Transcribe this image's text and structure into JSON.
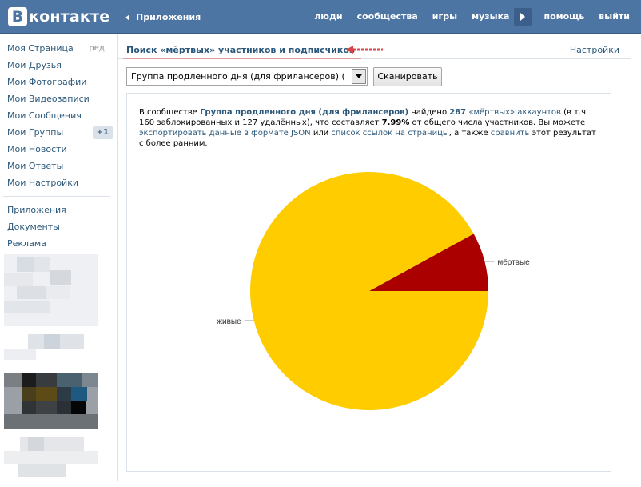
{
  "header": {
    "logo_letter": "В",
    "logo_text": "контакте",
    "apps_label": "Приложения",
    "nav": [
      "люди",
      "сообщества",
      "игры",
      "музыка",
      "помощь",
      "выйти"
    ]
  },
  "sidebar": {
    "items": [
      {
        "label": "Моя Страница",
        "extra": "ред."
      },
      {
        "label": "Мои Друзья"
      },
      {
        "label": "Мои Фотографии"
      },
      {
        "label": "Мои Видеозаписи"
      },
      {
        "label": "Мои Сообщения"
      },
      {
        "label": "Мои Группы",
        "count": "+1"
      },
      {
        "label": "Мои Новости"
      },
      {
        "label": "Мои Ответы"
      },
      {
        "label": "Мои Настройки"
      }
    ],
    "secondary": [
      {
        "label": "Приложения"
      },
      {
        "label": "Документы"
      },
      {
        "label": "Реклама"
      }
    ]
  },
  "main": {
    "tab_title": "Поиск «мёртвых» участников и подписчиков",
    "settings_label": "Настройки",
    "select_value": "Группа продленного дня (для фрилансеров) (",
    "scan_label": "Сканировать",
    "info": {
      "t1": "В сообществе ",
      "group_name": "Группа продленного дня (для фрилансеров)",
      "t2": " найдено ",
      "count": "287",
      "dead_link": " «мёртвых» аккаунтов",
      "t3": " (в т.ч. 160 заблокированных и 127 удалённых), что составляет ",
      "percent": "7.99%",
      "t4": " от общего числа участников. Вы можете ",
      "export_link": "экспортировать данные в формате JSON",
      "t5": " или ",
      "list_link": "список ссылок на страницы",
      "t6": ", а также ",
      "compare_link": "сравнить",
      "t7": " этот результат с более ранним."
    }
  },
  "colors": {
    "header_bg": "#4c75a3",
    "link": "#2b587a",
    "alive": "#ffcc00",
    "dead": "#aa0000"
  },
  "chart_data": {
    "type": "pie",
    "slices": [
      {
        "label": "мёртвые",
        "value": 7.99,
        "color": "#aa0000"
      },
      {
        "label": "живые",
        "value": 92.01,
        "color": "#ffcc00"
      }
    ]
  }
}
